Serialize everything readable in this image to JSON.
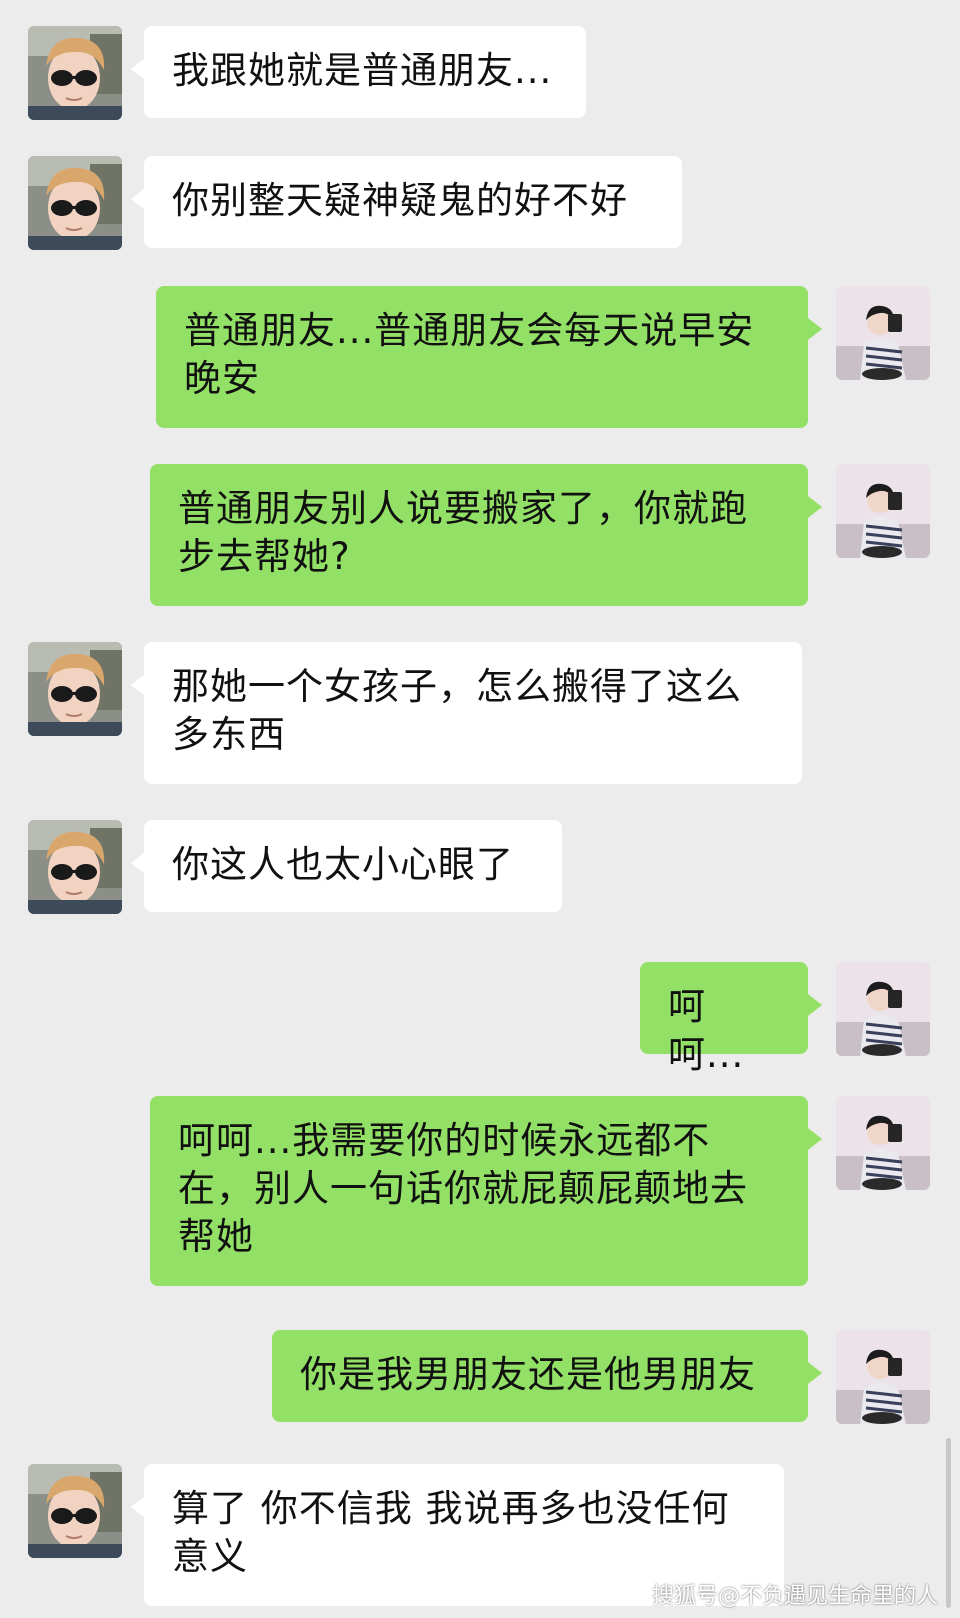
{
  "conversation": {
    "messages": [
      {
        "side": "left",
        "text": "我跟她就是普通朋友..."
      },
      {
        "side": "left",
        "text": "你别整天疑神疑鬼的好不好"
      },
      {
        "side": "right",
        "text": "普通朋友...普通朋友会每天说早安晚安"
      },
      {
        "side": "right",
        "text": "普通朋友别人说要搬家了，你就跑步去帮她?"
      },
      {
        "side": "left",
        "text": "那她一个女孩子，怎么搬得了这么多东西"
      },
      {
        "side": "left",
        "text": "你这人也太小心眼了"
      },
      {
        "side": "right",
        "text": "呵呵..."
      },
      {
        "side": "right",
        "text": "呵呵...我需要你的时候永远都不在，别人一句话你就屁颠屁颠地去帮她"
      },
      {
        "side": "right",
        "text": "你是我男朋友还是他男朋友"
      },
      {
        "side": "left",
        "text": "算了 你不信我 我说再多也没任何意义"
      }
    ]
  },
  "watermark": {
    "text": "搜狐号@不负遇见生命里的人"
  },
  "colors": {
    "background": "#ececec",
    "incoming_bubble": "#ffffff",
    "outgoing_bubble": "#93e066"
  },
  "icons": {
    "left_avatar": "avatar-boy-sunglasses-icon",
    "right_avatar": "avatar-girl-icon"
  }
}
